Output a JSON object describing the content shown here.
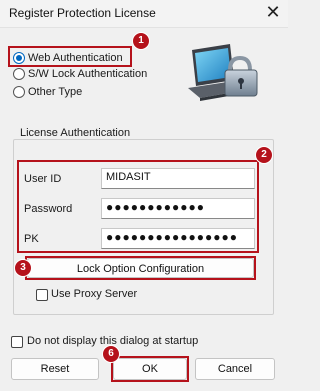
{
  "window": {
    "title": "Register Protection License",
    "close_glyph": "✕"
  },
  "license_type": {
    "options": [
      {
        "label": "Web Authentication",
        "selected": true
      },
      {
        "label": "S/W Lock Authentication",
        "selected": false
      },
      {
        "label": "Other Type",
        "selected": false
      }
    ]
  },
  "auth_group": {
    "title": "License Authentication",
    "user_id": {
      "label": "User ID",
      "value": "MIDASIT"
    },
    "password": {
      "label": "Password",
      "value": "●●●●●●●●●●●●"
    },
    "pk": {
      "label": "PK",
      "value": "●●●●●●●●●●●●●●●●"
    }
  },
  "lock_option_button": "Lock Option Configuration",
  "use_proxy": {
    "label": "Use Proxy Server",
    "checked": false
  },
  "no_show": {
    "label": "Do not display this dialog at startup",
    "checked": false
  },
  "buttons": {
    "reset": "Reset",
    "ok": "OK",
    "cancel": "Cancel"
  },
  "badges": {
    "b1": "1",
    "b2": "2",
    "b3": "3",
    "b6": "6"
  },
  "colors": {
    "callout": "#b5121b",
    "accent": "#0067c0"
  },
  "icon": "laptop-lock-icon"
}
